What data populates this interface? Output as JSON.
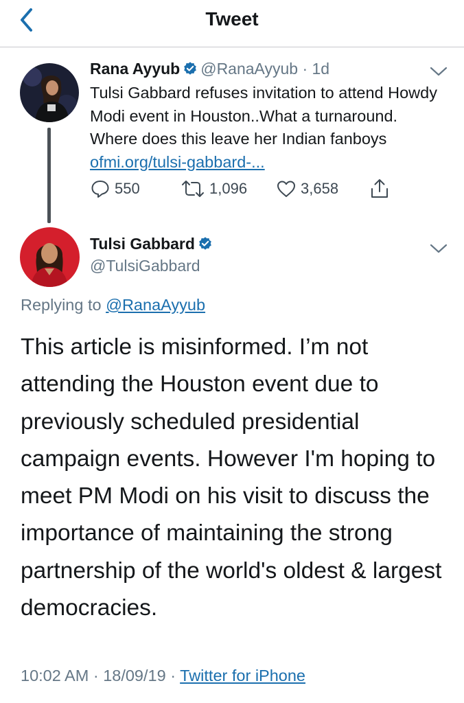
{
  "header": {
    "title": "Tweet",
    "back_icon": "chevron-left-icon",
    "accent": "#1b6fae"
  },
  "parent_tweet": {
    "author_name": "Rana Ayyub",
    "verified": true,
    "handle": "@RanaAyyub",
    "separator": "·",
    "age": "1d",
    "text": "Tulsi Gabbard refuses invitation to attend Howdy Modi event in Houston..What a turnaround. Where does this leave her Indian fanboys",
    "link_text": "ofmi.org/tulsi-gabbard-...",
    "replies": "550",
    "retweets": "1,096",
    "likes": "3,658",
    "icons": [
      "reply-icon",
      "retweet-icon",
      "like-icon",
      "share-icon"
    ]
  },
  "reply_tweet": {
    "author_name": "Tulsi Gabbard",
    "verified": true,
    "handle": "@TulsiGabbard",
    "replying_prefix": "Replying to",
    "replying_to": "@RanaAyyub",
    "text": "This article is misinformed. I’m not attending the Houston event due to previously scheduled presidential campaign events. However I'm hoping to meet PM Modi on his visit to discuss the importance of maintaining the strong partnership of the world's oldest & largest democracies.",
    "time": "10:02 AM",
    "date": "18/09/19",
    "separator": "·",
    "source": "Twitter for iPhone"
  },
  "colors": {
    "text": "#14171a",
    "secondary": "#657786",
    "link": "#1b6fae",
    "verified": "#1b6fae",
    "thread_line": "#4b5157"
  }
}
